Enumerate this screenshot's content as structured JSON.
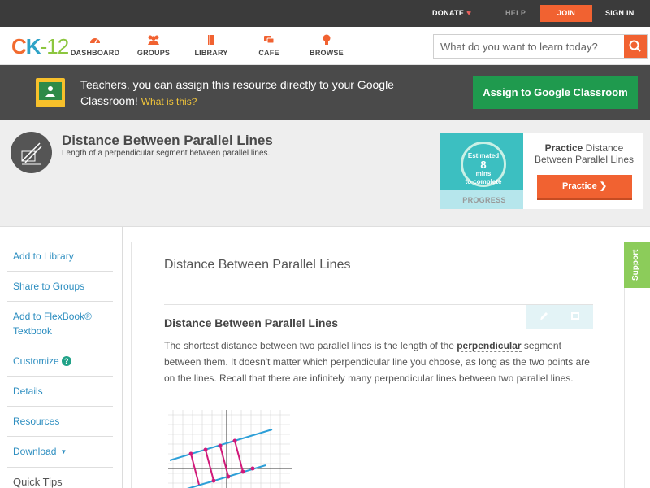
{
  "topbar": {
    "donate": "DONATE",
    "help": "HELP",
    "join": "JOIN",
    "signin": "SIGN IN"
  },
  "nav": {
    "logo": {
      "c": "C",
      "k": "K",
      "dash": "-",
      "n": "12"
    },
    "items": [
      {
        "label": "DASHBOARD",
        "icon": "dashboard-icon"
      },
      {
        "label": "GROUPS",
        "icon": "groups-icon"
      },
      {
        "label": "LIBRARY",
        "icon": "library-icon"
      },
      {
        "label": "CAFE",
        "icon": "cafe-icon"
      },
      {
        "label": "BROWSE",
        "icon": "browse-icon"
      }
    ],
    "search_placeholder": "What do you want to learn today?"
  },
  "classroom": {
    "message": "Teachers, you can assign this resource directly to your Google Classroom!",
    "what": "What is this?",
    "assign": "Assign to Google Classroom"
  },
  "concept": {
    "title": "Distance Between Parallel Lines",
    "subtitle": "Length of a perpendicular segment between parallel lines."
  },
  "practice": {
    "estimated": "Estimated",
    "minutes": "8",
    "mins": "mins",
    "complete": "to complete",
    "progress": "PROGRESS",
    "label_bold": "Practice",
    "label_rest": "Distance Between Parallel Lines",
    "button": "Practice"
  },
  "sidebar": {
    "items": [
      {
        "label": "Add to Library"
      },
      {
        "label": "Share to Groups"
      },
      {
        "label": "Add to FlexBook® Textbook"
      },
      {
        "label": "Customize"
      },
      {
        "label": "Details"
      },
      {
        "label": "Resources"
      },
      {
        "label": "Download"
      }
    ],
    "quick_tips": "Quick Tips"
  },
  "content": {
    "title": "Distance Between Parallel Lines",
    "heading": "Distance Between Parallel Lines",
    "para_before": "The shortest distance between two parallel lines is the length of the ",
    "para_term": "perpendicular",
    "para_after": " segment between them. It doesn't matter which perpendicular line you choose, as long as the two points are on the lines. Recall that there are infinitely many perpendicular lines between two parallel lines."
  },
  "support": "Support",
  "colors": {
    "accent_orange": "#f16231",
    "google_green": "#1f9a4e",
    "link_blue": "#2d8ec0",
    "support_green": "#8ccc5a"
  }
}
